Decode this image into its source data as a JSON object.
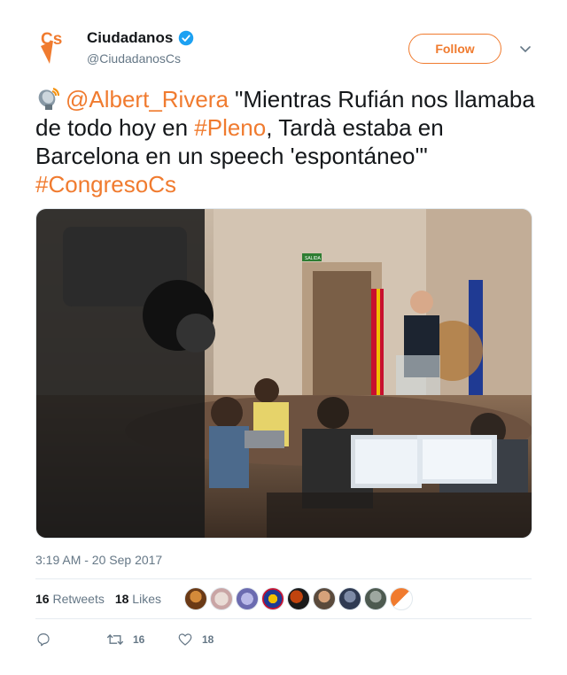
{
  "account": {
    "display_name": "Ciudadanos",
    "handle": "@CiudadanosCs",
    "logo_text": "Cs",
    "verified": true,
    "brand_color": "#f07b2f"
  },
  "follow_label": "Follow",
  "tweet": {
    "emoji": "satellite-antenna-icon",
    "mention": "@Albert_Rivera",
    "text_1": " \"Mientras Rufián nos llamaba de todo hoy en ",
    "hashtag_1": "#Pleno",
    "text_2": ", Tardà estaba en Barcelona en un speech 'espontáneo'\" ",
    "hashtag_2": "#CongresoCs"
  },
  "photo": {
    "sign_text": "SALIDA"
  },
  "timestamp": "3:19 AM - 20 Sep 2017",
  "stats": {
    "retweets_count": "16",
    "retweets_label": "Retweets",
    "likes_count": "18",
    "likes_label": "Likes"
  },
  "actions": {
    "reply_icon": "reply-icon",
    "retweet_icon": "retweet-icon",
    "retweet_count": "16",
    "like_icon": "heart-icon",
    "like_count": "18"
  }
}
